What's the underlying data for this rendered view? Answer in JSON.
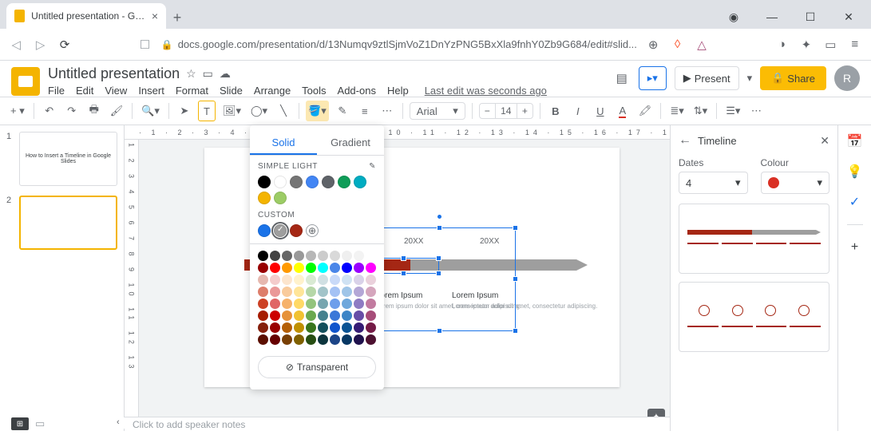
{
  "browser": {
    "tab_title": "Untitled presentation - Google Sl",
    "url": "docs.google.com/presentation/d/13Numqv9ztlSjmVoZ1DnYzPNG5BxXla9fnhY0Zb9G684/edit#slid..."
  },
  "doc": {
    "title": "Untitled presentation",
    "menus": [
      "File",
      "Edit",
      "View",
      "Insert",
      "Format",
      "Slide",
      "Arrange",
      "Tools",
      "Add-ons",
      "Help"
    ],
    "last_edit": "Last edit was seconds ago",
    "present": "Present",
    "share": "Share",
    "avatar": "R"
  },
  "toolbar": {
    "font": "Arial",
    "size": "14"
  },
  "colorpop": {
    "tab_solid": "Solid",
    "tab_gradient": "Gradient",
    "theme_label": "SIMPLE LIGHT",
    "custom_label": "CUSTOM",
    "transparent": "Transparent",
    "theme_colors": [
      "#000000",
      "#ffffff",
      "#757575",
      "#4285f4",
      "#5f6368",
      "#0f9d58",
      "#00acc1",
      "#f4b400",
      "#9ccc65"
    ],
    "custom_colors": [
      "#1a73e8",
      "#9e9e9e",
      "#a52714"
    ],
    "palette": [
      "#000000",
      "#434343",
      "#666666",
      "#999999",
      "#b7b7b7",
      "#cccccc",
      "#d9d9d9",
      "#efefef",
      "#f3f3f3",
      "#ffffff",
      "#980000",
      "#ff0000",
      "#ff9900",
      "#ffff00",
      "#00ff00",
      "#00ffff",
      "#4a86e8",
      "#0000ff",
      "#9900ff",
      "#ff00ff",
      "#e6b8af",
      "#f4cccc",
      "#fce5cd",
      "#fff2cc",
      "#d9ead3",
      "#d0e0e3",
      "#c9daf8",
      "#cfe2f3",
      "#d9d2e9",
      "#ead1dc",
      "#dd7e6b",
      "#ea9999",
      "#f9cb9c",
      "#ffe599",
      "#b6d7a8",
      "#a2c4c9",
      "#a4c2f4",
      "#9fc5e8",
      "#b4a7d6",
      "#d5a6bd",
      "#cc4125",
      "#e06666",
      "#f6b26b",
      "#ffd966",
      "#93c47d",
      "#76a5af",
      "#6d9eeb",
      "#6fa8dc",
      "#8e7cc3",
      "#c27ba0",
      "#a61c00",
      "#cc0000",
      "#e69138",
      "#f1c232",
      "#6aa84f",
      "#45818e",
      "#3c78d8",
      "#3d85c6",
      "#674ea7",
      "#a64d79",
      "#85200c",
      "#990000",
      "#b45f06",
      "#bf9000",
      "#38761d",
      "#134f5c",
      "#1155cc",
      "#0b5394",
      "#351c75",
      "#741b47",
      "#5b0f00",
      "#660000",
      "#783f04",
      "#7f6000",
      "#274e13",
      "#0c343d",
      "#1c4587",
      "#073763",
      "#20124d",
      "#4c1130"
    ]
  },
  "sidepanel": {
    "title": "Timeline",
    "dates_lbl": "Dates",
    "dates_val": "4",
    "color_lbl": "Colour"
  },
  "canvas": {
    "year1": "20XX",
    "year2": "20XX",
    "lorem": "Lorem Ipsum",
    "loremsub": "Lorem ipsum dolor sit amet, consectetur adipiscing."
  },
  "thumbs": {
    "s1": "How to Insert a Timeline in Google Slides"
  },
  "notes": "Click to add speaker notes"
}
